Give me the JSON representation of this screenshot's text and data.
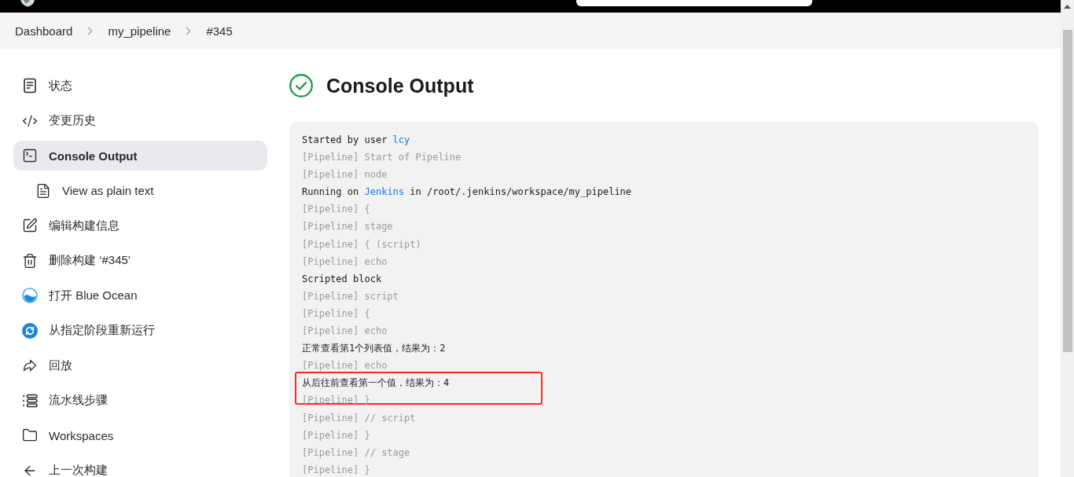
{
  "breadcrumbs": [
    "Dashboard",
    "my_pipeline",
    "#345"
  ],
  "sidebar": {
    "items": [
      {
        "label": "状态",
        "selected": false
      },
      {
        "label": "变更历史",
        "selected": false
      },
      {
        "label": "Console Output",
        "selected": true,
        "children": [
          {
            "label": "View as plain text",
            "selected": false
          }
        ]
      },
      {
        "label": "编辑构建信息",
        "selected": false
      },
      {
        "label": "删除构建 ‘#345’",
        "selected": false
      },
      {
        "label": "打开 Blue Ocean",
        "selected": false
      },
      {
        "label": "从指定阶段重新运行",
        "selected": false
      },
      {
        "label": "回放",
        "selected": false
      },
      {
        "label": "流水线步骤",
        "selected": false
      },
      {
        "label": "Workspaces",
        "selected": false
      },
      {
        "label": "上一次构建",
        "selected": false
      }
    ]
  },
  "page": {
    "title": "Console Output"
  },
  "console": {
    "lines": [
      {
        "kind": "output",
        "highlighted": false,
        "segments": [
          {
            "kind": "text",
            "text": "Started by user"
          },
          {
            "kind": "link",
            "text": "lcy"
          }
        ]
      },
      {
        "kind": "step",
        "highlighted": false,
        "text": "[Pipeline] Start of Pipeline"
      },
      {
        "kind": "step",
        "highlighted": false,
        "text": "[Pipeline] node"
      },
      {
        "kind": "output",
        "highlighted": false,
        "segments": [
          {
            "kind": "text",
            "text": "Running on"
          },
          {
            "kind": "link",
            "text": "Jenkins"
          },
          {
            "kind": "text",
            "text": "in /root/.jenkins/workspace/my_pipeline"
          }
        ]
      },
      {
        "kind": "step",
        "highlighted": false,
        "text": "[Pipeline] {"
      },
      {
        "kind": "step",
        "highlighted": false,
        "text": "[Pipeline] stage"
      },
      {
        "kind": "step",
        "highlighted": false,
        "text": "[Pipeline] { (script)"
      },
      {
        "kind": "step",
        "highlighted": false,
        "text": "[Pipeline] echo"
      },
      {
        "kind": "output",
        "highlighted": false,
        "text": "Scripted block"
      },
      {
        "kind": "step",
        "highlighted": false,
        "text": "[Pipeline] script"
      },
      {
        "kind": "step",
        "highlighted": false,
        "text": "[Pipeline] {"
      },
      {
        "kind": "step",
        "highlighted": false,
        "text": "[Pipeline] echo"
      },
      {
        "kind": "output",
        "highlighted": false,
        "text": "正常查看第1个列表值，结果为：2"
      },
      {
        "kind": "step",
        "highlighted": false,
        "text": "[Pipeline] echo"
      },
      {
        "kind": "output",
        "highlighted": true,
        "text": "从后往前查看第一个值，结果为：4"
      },
      {
        "kind": "step",
        "highlighted": false,
        "text": "[Pipeline] }"
      },
      {
        "kind": "step",
        "highlighted": false,
        "text": "[Pipeline] // script"
      },
      {
        "kind": "step",
        "highlighted": false,
        "text": "[Pipeline] }"
      },
      {
        "kind": "step",
        "highlighted": false,
        "text": "[Pipeline] // stage"
      },
      {
        "kind": "step",
        "highlighted": false,
        "text": "[Pipeline] }"
      }
    ]
  }
}
